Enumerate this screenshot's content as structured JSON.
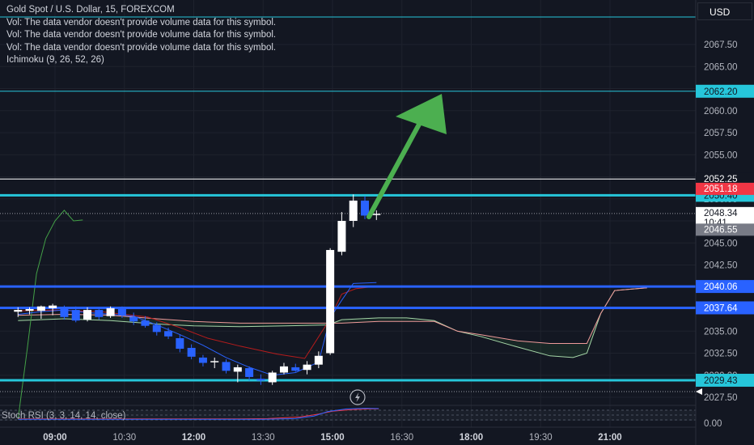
{
  "legend": {
    "symbol": "Gold Spot / U.S. Dollar, 15, FOREXCOM",
    "vol_lines": [
      "Vol: The data vendor doesn't provide volume data for this symbol.",
      "Vol: The data vendor doesn't provide volume data for this symbol.",
      "Vol: The data vendor doesn't provide volume data for this symbol."
    ],
    "ichimoku": "Ichimoku (9, 26, 52, 26)"
  },
  "currency_button": "USD",
  "stoch_label": "Stoch RSI (3, 3, 14, 14, close)",
  "colors": {
    "background": "#131722",
    "up_candle": "#ffffff",
    "down_candle": "#2962ff",
    "cyan_line": "#26c6da",
    "blue_line": "#2962ff",
    "arrow": "#4caf50",
    "red_badge": "#f23645"
  },
  "chart_data": {
    "type": "candlestick",
    "yaxis_ticks": [
      "2067.50",
      "2065.00",
      "2062.50",
      "2060.00",
      "2057.50",
      "2055.00",
      "2052.50",
      "2050.00",
      "2047.50",
      "2045.00",
      "2042.50",
      "2040.00",
      "2037.50",
      "2035.00",
      "2032.50",
      "2030.00",
      "2027.50"
    ],
    "xaxis_ticks": [
      "09:00",
      "10:30",
      "12:00",
      "13:30",
      "15:00",
      "16:30",
      "18:00",
      "19:30",
      "21:00"
    ],
    "stoch_tick": "0.00",
    "horizontal_levels": [
      {
        "value": 2062.2,
        "label": "2062.20",
        "color": "#26c6da",
        "kind": "thin"
      },
      {
        "value": 2050.4,
        "label": "2050.40",
        "color": "#26c6da",
        "kind": "thick"
      },
      {
        "value": 2040.06,
        "label": "2040.06",
        "color": "#2962ff",
        "kind": "thick"
      },
      {
        "value": 2037.64,
        "label": "2037.64",
        "color": "#2962ff",
        "kind": "thick"
      },
      {
        "value": 2029.43,
        "label": "2029.43",
        "color": "#26c6da",
        "kind": "thick"
      },
      {
        "value": 2052.25,
        "label": "2052.25",
        "color": "#ffffff",
        "kind": "white"
      }
    ],
    "price_badges": [
      {
        "value": 2051.18,
        "label": "2051.18",
        "bg": "#f23645",
        "fg": "#ffffff"
      },
      {
        "value": 2048.34,
        "label": "2048.34",
        "sub": "10:41",
        "bg": "#ffffff",
        "fg": "#131722"
      },
      {
        "value": 2046.55,
        "label": "2046.55",
        "bg": "#787b86",
        "fg": "#ffffff"
      }
    ],
    "current_price": 2048.34,
    "candles": [
      {
        "t": 8.2,
        "o": 2037.2,
        "h": 2037.7,
        "l": 2036.6,
        "c": 2037.4
      },
      {
        "t": 8.45,
        "o": 2037.3,
        "h": 2037.7,
        "l": 2036.9,
        "c": 2037.5
      },
      {
        "t": 8.7,
        "o": 2037.3,
        "h": 2037.9,
        "l": 2036.4,
        "c": 2037.8
      },
      {
        "t": 8.95,
        "o": 2037.6,
        "h": 2038.1,
        "l": 2036.8,
        "c": 2037.9
      },
      {
        "t": 9.2,
        "o": 2037.7,
        "h": 2037.9,
        "l": 2036.3,
        "c": 2036.6
      },
      {
        "t": 9.45,
        "o": 2037.4,
        "h": 2037.8,
        "l": 2036.0,
        "c": 2036.2
      },
      {
        "t": 9.7,
        "o": 2036.3,
        "h": 2037.7,
        "l": 2036.1,
        "c": 2037.4
      },
      {
        "t": 9.95,
        "o": 2037.4,
        "h": 2037.6,
        "l": 2036.3,
        "c": 2036.6
      },
      {
        "t": 10.2,
        "o": 2036.7,
        "h": 2037.8,
        "l": 2036.5,
        "c": 2037.6
      },
      {
        "t": 10.45,
        "o": 2037.5,
        "h": 2037.8,
        "l": 2036.5,
        "c": 2036.8
      },
      {
        "t": 10.7,
        "o": 2036.6,
        "h": 2037.1,
        "l": 2035.7,
        "c": 2036.1
      },
      {
        "t": 10.95,
        "o": 2036.2,
        "h": 2036.7,
        "l": 2035.4,
        "c": 2035.6
      },
      {
        "t": 11.2,
        "o": 2035.7,
        "h": 2036.0,
        "l": 2034.5,
        "c": 2034.9
      },
      {
        "t": 11.45,
        "o": 2035.0,
        "h": 2035.4,
        "l": 2034.1,
        "c": 2034.4
      },
      {
        "t": 11.7,
        "o": 2034.2,
        "h": 2034.6,
        "l": 2032.6,
        "c": 2033.0
      },
      {
        "t": 11.95,
        "o": 2033.1,
        "h": 2033.5,
        "l": 2031.8,
        "c": 2032.1
      },
      {
        "t": 12.2,
        "o": 2032.0,
        "h": 2032.3,
        "l": 2031.0,
        "c": 2031.4
      },
      {
        "t": 12.45,
        "o": 2031.5,
        "h": 2032.0,
        "l": 2030.8,
        "c": 2031.6
      },
      {
        "t": 12.7,
        "o": 2031.5,
        "h": 2031.8,
        "l": 2030.2,
        "c": 2030.5
      },
      {
        "t": 12.95,
        "o": 2030.4,
        "h": 2031.2,
        "l": 2029.2,
        "c": 2030.9
      },
      {
        "t": 13.2,
        "o": 2030.8,
        "h": 2031.0,
        "l": 2029.4,
        "c": 2029.8
      },
      {
        "t": 13.45,
        "o": 2029.6,
        "h": 2030.1,
        "l": 2028.9,
        "c": 2029.4
      },
      {
        "t": 13.7,
        "o": 2029.2,
        "h": 2030.5,
        "l": 2028.9,
        "c": 2030.3
      },
      {
        "t": 13.95,
        "o": 2030.3,
        "h": 2031.4,
        "l": 2030.1,
        "c": 2031.0
      },
      {
        "t": 14.2,
        "o": 2030.9,
        "h": 2031.3,
        "l": 2030.4,
        "c": 2030.5
      },
      {
        "t": 14.45,
        "o": 2030.6,
        "h": 2031.6,
        "l": 2030.1,
        "c": 2031.2
      },
      {
        "t": 14.7,
        "o": 2031.2,
        "h": 2032.7,
        "l": 2030.8,
        "c": 2032.2
      },
      {
        "t": 14.95,
        "o": 2032.5,
        "h": 2044.4,
        "l": 2032.3,
        "c": 2044.2
      },
      {
        "t": 15.2,
        "o": 2044.0,
        "h": 2048.5,
        "l": 2043.6,
        "c": 2047.5
      },
      {
        "t": 15.45,
        "o": 2047.5,
        "h": 2050.5,
        "l": 2046.8,
        "c": 2049.8
      },
      {
        "t": 15.7,
        "o": 2049.8,
        "h": 2050.3,
        "l": 2047.7,
        "c": 2048.1
      },
      {
        "t": 15.95,
        "o": 2048.2,
        "h": 2048.7,
        "l": 2047.6,
        "c": 2048.3
      }
    ],
    "ichimoku": {
      "tenkan": [
        [
          8.2,
          2036.9
        ],
        [
          8.7,
          2037.2
        ],
        [
          9.2,
          2037.4
        ],
        [
          9.7,
          2037.1
        ],
        [
          10.2,
          2036.9
        ],
        [
          10.7,
          2036.7
        ],
        [
          11.2,
          2035.7
        ],
        [
          11.7,
          2034.6
        ],
        [
          12.2,
          2033.4
        ],
        [
          12.7,
          2032.0
        ],
        [
          13.2,
          2030.9
        ],
        [
          13.7,
          2030.0
        ],
        [
          14.2,
          2030.3
        ],
        [
          14.7,
          2031.5
        ],
        [
          14.95,
          2036.5
        ],
        [
          15.2,
          2038.5
        ],
        [
          15.45,
          2040.4
        ],
        [
          15.95,
          2040.5
        ]
      ],
      "kijun": [
        [
          8.2,
          2037.3
        ],
        [
          9.0,
          2037.4
        ],
        [
          10.0,
          2037.2
        ],
        [
          11.0,
          2036.6
        ],
        [
          11.7,
          2035.4
        ],
        [
          12.3,
          2034.2
        ],
        [
          13.0,
          2033.3
        ],
        [
          13.8,
          2032.4
        ],
        [
          14.4,
          2031.9
        ],
        [
          14.9,
          2036.0
        ],
        [
          15.2,
          2039.2
        ],
        [
          15.5,
          2039.8
        ],
        [
          15.95,
          2040.1
        ]
      ],
      "span_a": [
        [
          8.2,
          2036.2
        ],
        [
          9.2,
          2036.4
        ],
        [
          10.2,
          2036.2
        ],
        [
          11.2,
          2035.8
        ],
        [
          12.0,
          2035.6
        ],
        [
          13.0,
          2035.5
        ],
        [
          14.0,
          2035.6
        ],
        [
          14.9,
          2035.7
        ],
        [
          15.2,
          2036.3
        ],
        [
          16.0,
          2036.5
        ],
        [
          16.6,
          2036.5
        ],
        [
          17.2,
          2036.2
        ],
        [
          17.7,
          2035.0
        ],
        [
          18.2,
          2034.4
        ],
        [
          19.0,
          2033.2
        ],
        [
          19.7,
          2032.2
        ],
        [
          20.2,
          2032.0
        ],
        [
          20.5,
          2032.5
        ],
        [
          20.8,
          2037.0
        ],
        [
          21.1,
          2039.6
        ],
        [
          21.8,
          2039.9
        ]
      ],
      "span_b": [
        [
          8.2,
          2036.8
        ],
        [
          9.2,
          2036.9
        ],
        [
          10.2,
          2036.8
        ],
        [
          11.2,
          2036.4
        ],
        [
          12.0,
          2036.1
        ],
        [
          13.0,
          2035.9
        ],
        [
          14.0,
          2035.9
        ],
        [
          14.9,
          2035.9
        ],
        [
          15.2,
          2035.9
        ],
        [
          16.0,
          2036.1
        ],
        [
          16.6,
          2036.1
        ],
        [
          17.2,
          2036.1
        ],
        [
          17.7,
          2035.0
        ],
        [
          18.2,
          2034.6
        ],
        [
          19.0,
          2033.9
        ],
        [
          19.7,
          2033.6
        ],
        [
          20.2,
          2033.6
        ],
        [
          20.5,
          2033.6
        ],
        [
          20.8,
          2037.0
        ],
        [
          21.1,
          2039.6
        ],
        [
          21.8,
          2039.9
        ]
      ],
      "chikou": [
        [
          8.2,
          2025.0
        ],
        [
          8.4,
          2033.0
        ],
        [
          8.6,
          2041.5
        ],
        [
          8.8,
          2045.5
        ],
        [
          9.0,
          2047.5
        ],
        [
          9.2,
          2048.7
        ],
        [
          9.4,
          2047.5
        ],
        [
          9.6,
          2047.6
        ]
      ]
    },
    "stoch_rsi": {
      "k": [
        [
          8.2,
          0.2
        ],
        [
          9.0,
          0.2
        ],
        [
          10.0,
          0.2
        ],
        [
          11.0,
          0.2
        ],
        [
          12.0,
          0.2
        ],
        [
          13.0,
          0.2
        ],
        [
          13.5,
          0.2
        ],
        [
          14.2,
          0.4
        ],
        [
          14.6,
          1.2
        ],
        [
          14.9,
          2.6
        ],
        [
          15.3,
          3.4
        ],
        [
          15.7,
          3.6
        ],
        [
          16.0,
          3.5
        ]
      ],
      "d": [
        [
          8.2,
          0.3
        ],
        [
          9.0,
          0.3
        ],
        [
          10.0,
          0.3
        ],
        [
          11.0,
          0.3
        ],
        [
          12.0,
          0.3
        ],
        [
          13.0,
          0.3
        ],
        [
          13.6,
          0.4
        ],
        [
          14.3,
          0.9
        ],
        [
          14.7,
          1.8
        ],
        [
          15.0,
          2.7
        ],
        [
          15.4,
          3.2
        ],
        [
          15.8,
          3.4
        ],
        [
          16.0,
          3.4
        ]
      ]
    }
  }
}
